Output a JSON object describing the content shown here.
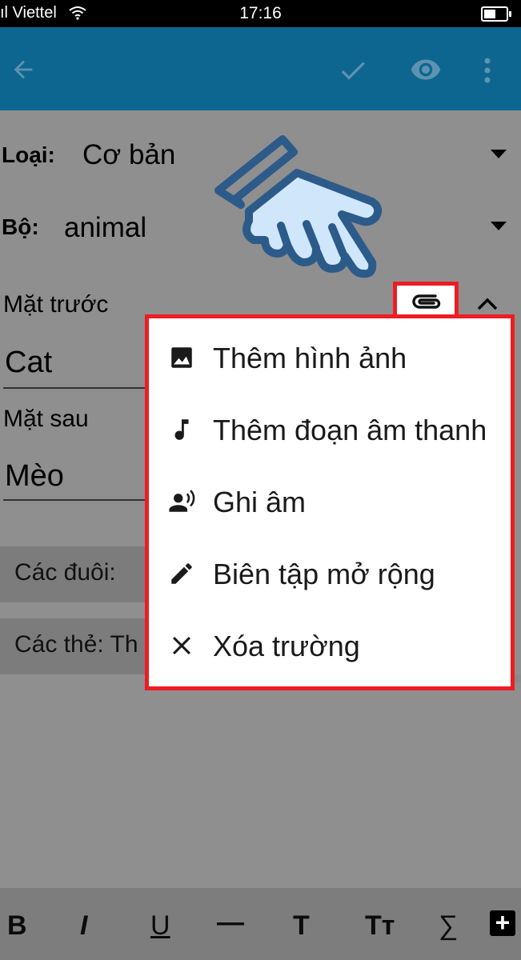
{
  "status_bar": {
    "carrier": "ıl Viettel",
    "time": "17:16",
    "battery_level": 0.55
  },
  "app_bar": {
    "back_icon": "arrow-left-icon",
    "save_icon": "check-icon",
    "preview_icon": "eye-icon",
    "menu_icon": "more-vert-icon"
  },
  "form": {
    "type_label": "Loại:",
    "type_value": "Cơ bản",
    "deck_label": "Bộ:",
    "deck_value": "animal",
    "front_label": "Mặt trước",
    "front_value": "Cat",
    "back_label": "Mặt sau",
    "back_value": "Mèo",
    "tags_label": "Các đuôi:",
    "cards_label": "Các thẻ: Th"
  },
  "menu": {
    "items": [
      {
        "label": "Thêm hình ảnh",
        "icon": "image-icon"
      },
      {
        "label": "Thêm đoạn âm thanh",
        "icon": "music-note-icon"
      },
      {
        "label": "Ghi âm",
        "icon": "record-voice-icon"
      },
      {
        "label": "Biên tập mở rộng",
        "icon": "pencil-icon"
      },
      {
        "label": "Xóa trường",
        "icon": "close-icon"
      }
    ]
  },
  "toolbar": {
    "bold": "B",
    "italic": "I",
    "underline": "U",
    "hr": "—",
    "title": "T",
    "font_size": "Tт",
    "cloze": "∑",
    "add": "+"
  },
  "colors": {
    "accent_bar": "#0d6690",
    "highlight": "#ee1c23",
    "pointer_stroke": "#2c5b8a",
    "pointer_fill": "#cfe6fb"
  }
}
